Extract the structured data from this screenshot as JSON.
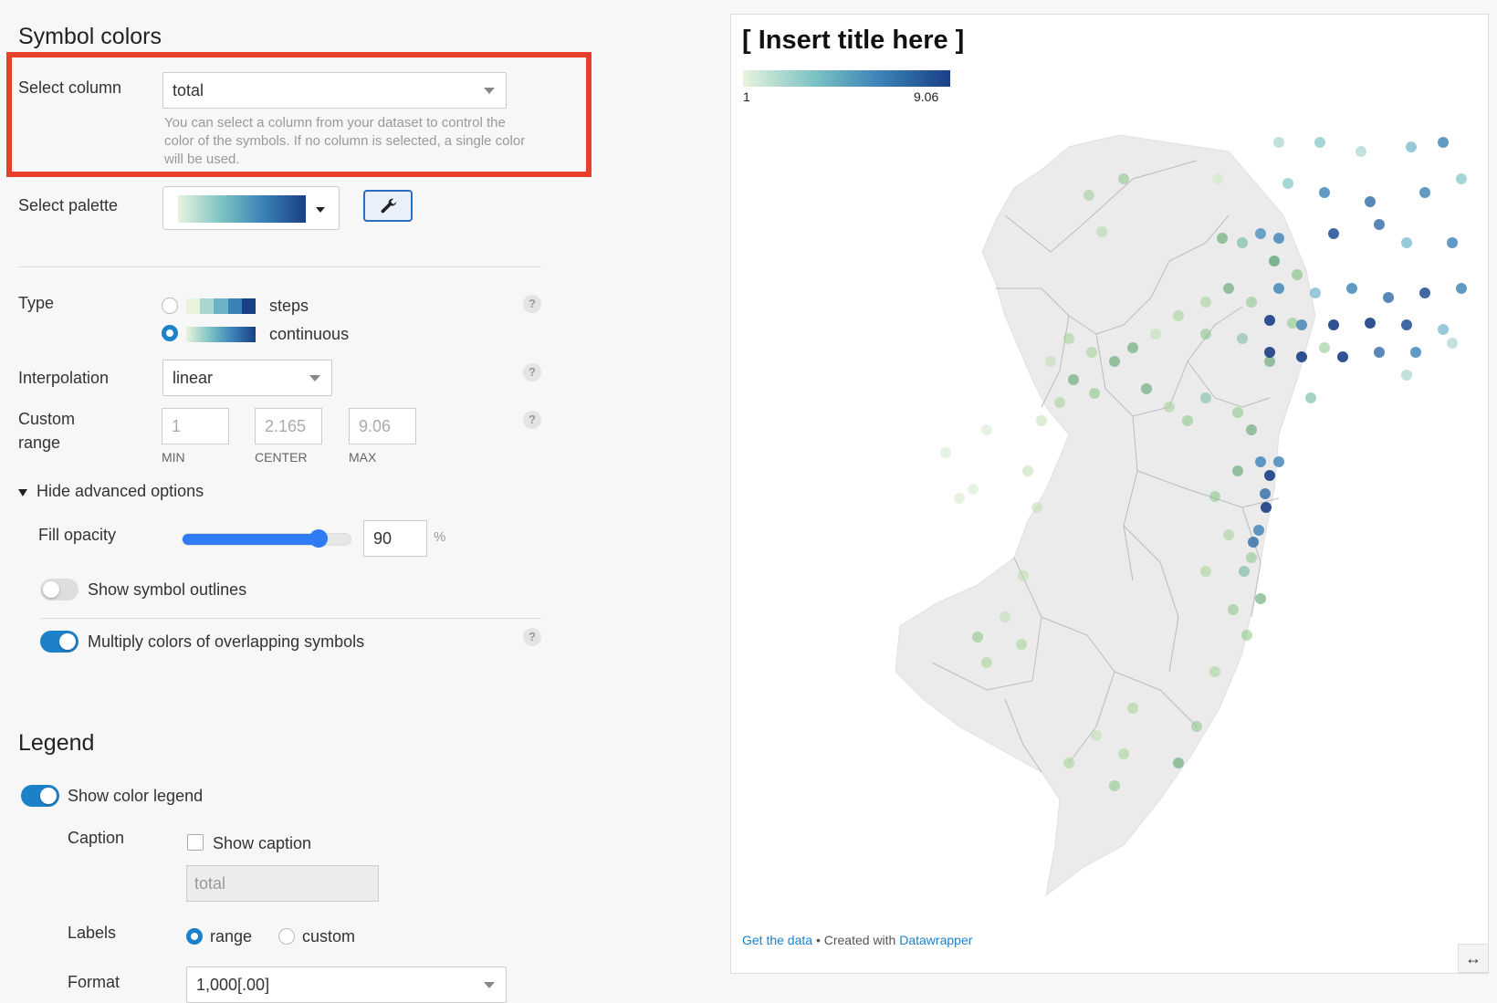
{
  "symbol_colors": {
    "heading": "Symbol colors",
    "select_column_label": "Select column",
    "select_column_value": "total",
    "select_column_help": "You can select a column from your dataset to control the color of the symbols. If no column is selected, a single color will be used.",
    "select_palette_label": "Select palette",
    "type_label": "Type",
    "type_options": [
      "steps",
      "continuous"
    ],
    "type_selected": "continuous",
    "interpolation_label": "Interpolation",
    "interpolation_value": "linear",
    "custom_range_label_1": "Custom",
    "custom_range_label_2": "range",
    "range_min": "1",
    "range_center": "2.165",
    "range_max": "9.06",
    "range_min_label": "MIN",
    "range_center_label": "CENTER",
    "range_max_label": "MAX",
    "advanced_toggle": "Hide advanced options",
    "fill_opacity_label": "Fill opacity",
    "fill_opacity_value": "90",
    "fill_opacity_unit": "%",
    "fill_opacity_fraction": 0.9,
    "show_outlines_label": "Show symbol outlines",
    "show_outlines_on": false,
    "multiply_label": "Multiply colors of overlapping symbols",
    "multiply_on": true,
    "help_glyph": "?"
  },
  "legend": {
    "heading": "Legend",
    "show_color_legend_label": "Show color legend",
    "show_color_legend_on": true,
    "caption_label": "Caption",
    "show_caption_label": "Show caption",
    "show_caption_checked": false,
    "caption_value": "total",
    "labels_label": "Labels",
    "labels_options": [
      "range",
      "custom"
    ],
    "labels_selected": "range",
    "format_label": "Format",
    "format_value": "1,000[.00]"
  },
  "colors": {
    "accent": "#1d81c9",
    "highlight_box": "#e8402a",
    "palette_light": "#e8f3dd",
    "palette_dark": "#1a3f86"
  },
  "preview": {
    "title": "[ Insert title here ]",
    "legend_min": "1",
    "legend_max": "9.06",
    "footer_link_data": "Get the data",
    "footer_sep": " • Created with ",
    "footer_link_tool": "Datawrapper",
    "resize_icon": "↔"
  },
  "icons": {
    "wrench": "wrench-icon",
    "resize": "resize-horizontal-icon",
    "triangle": "triangle-down-icon"
  }
}
